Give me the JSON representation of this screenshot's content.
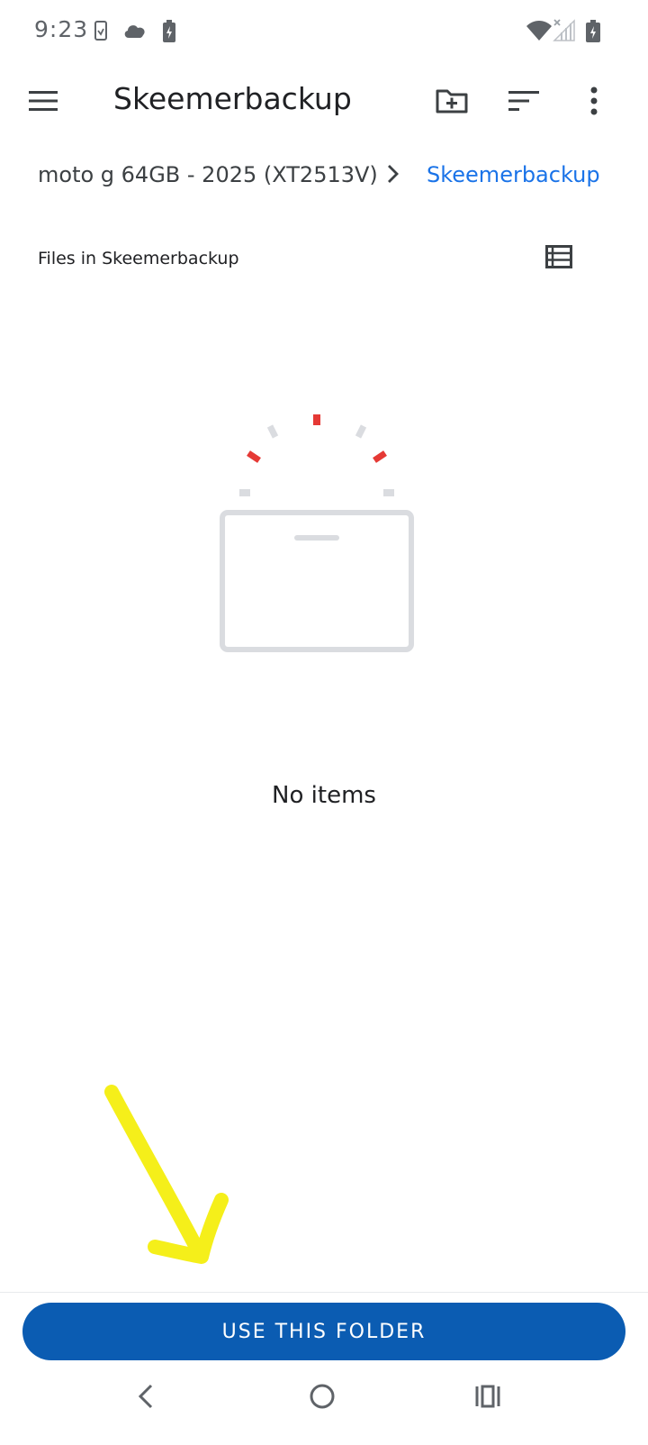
{
  "status_bar": {
    "time": "9:23",
    "icons": [
      "sim-card-icon",
      "cloud-icon",
      "battery-charging-icon",
      "wifi-icon",
      "cellular-no-signal-icon",
      "battery-icon"
    ]
  },
  "app_bar": {
    "title": "Skeemerbackup",
    "icons": [
      "menu-icon",
      "new-folder-icon",
      "sort-icon",
      "more-options-icon"
    ]
  },
  "breadcrumb": {
    "root": "moto g 64GB - 2025 (XT2513V)",
    "separator_icon": "chevron-right-icon",
    "current": "Skeemerbackup"
  },
  "content": {
    "section_title": "Files in Skeemerbackup",
    "view_toggle_icon": "list-view-icon",
    "empty_illustration": "empty-box-illustration",
    "empty_text": "No items"
  },
  "actions": {
    "use_folder_label": "USE THIS FOLDER"
  },
  "nav_bar": {
    "icons": [
      "back-icon",
      "home-icon",
      "recents-icon"
    ]
  },
  "colors": {
    "accent": "#1a73e8",
    "button": "#0b5cb2",
    "annotation": "#f5ef1a",
    "illustration_red": "#e53935",
    "illustration_gray": "#dadce0"
  }
}
